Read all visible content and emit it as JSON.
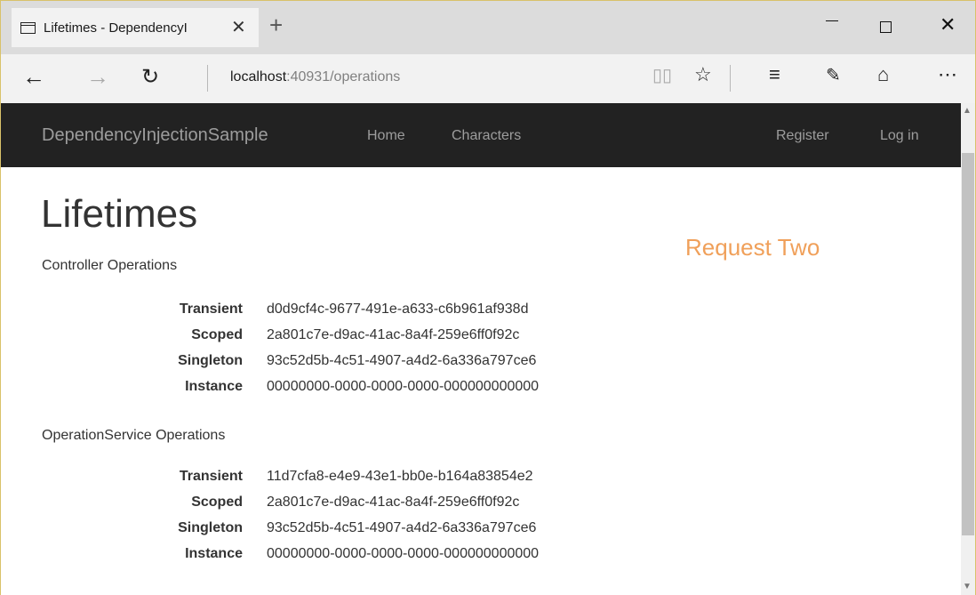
{
  "browser": {
    "tab_title": "Lifetimes - DependencyI",
    "tab_close": "✕",
    "new_tab": "+",
    "url_host": "localhost",
    "url_rest": ":40931/operations",
    "icons": [
      "tab-icon",
      "back-icon",
      "forward-icon",
      "refresh-icon",
      "reading-view-icon",
      "favorite-star-icon",
      "hub-icon",
      "web-note-icon",
      "share-icon",
      "more-icon"
    ]
  },
  "navbar": {
    "brand": "DependencyInjectionSample",
    "links": [
      "Home",
      "Characters"
    ],
    "right_links": [
      "Register",
      "Log in"
    ]
  },
  "main": {
    "title": "Lifetimes",
    "request_label": "Request Two",
    "request_color": "#f0a05a",
    "sections": [
      {
        "heading": "Controller Operations",
        "rows": [
          {
            "key": "Transient",
            "value": "d0d9cf4c-9677-491e-a633-c6b961af938d"
          },
          {
            "key": "Scoped",
            "value": "2a801c7e-d9ac-41ac-8a4f-259e6ff0f92c"
          },
          {
            "key": "Singleton",
            "value": "93c52d5b-4c51-4907-a4d2-6a336a797ce6"
          },
          {
            "key": "Instance",
            "value": "00000000-0000-0000-0000-000000000000"
          }
        ]
      },
      {
        "heading": "OperationService Operations",
        "rows": [
          {
            "key": "Transient",
            "value": "11d7cfa8-e4e9-43e1-bb0e-b164a83854e2"
          },
          {
            "key": "Scoped",
            "value": "2a801c7e-d9ac-41ac-8a4f-259e6ff0f92c"
          },
          {
            "key": "Singleton",
            "value": "93c52d5b-4c51-4907-a4d2-6a336a797ce6"
          },
          {
            "key": "Instance",
            "value": "00000000-0000-0000-0000-000000000000"
          }
        ]
      }
    ]
  }
}
